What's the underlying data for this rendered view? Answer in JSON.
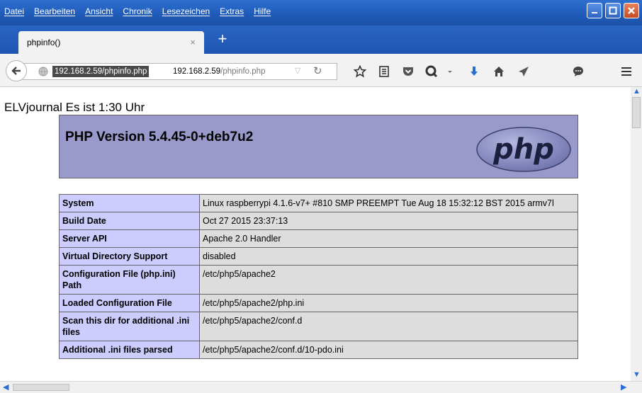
{
  "menubar": {
    "items": [
      "Datei",
      "Bearbeiten",
      "Ansicht",
      "Chronik",
      "Lesezeichen",
      "Extras",
      "Hilfe"
    ]
  },
  "tab": {
    "title": "phpinfo()",
    "close": "×",
    "new_tab": "+"
  },
  "navbar": {
    "url_selected": "192.168.2.59/phpinfo.php",
    "url_host": "192.168.2.59",
    "url_path": "/phpinfo.php"
  },
  "page": {
    "heading": "ELVjournal Es ist 1:30 Uhr",
    "php_version": "PHP Version 5.4.45-0+deb7u2",
    "logo_text": "php",
    "rows": [
      {
        "key": "System",
        "value": "Linux raspberrypi 4.1.6-v7+ #810 SMP PREEMPT Tue Aug 18 15:32:12 BST 2015 armv7l"
      },
      {
        "key": "Build Date",
        "value": "Oct 27 2015 23:37:13"
      },
      {
        "key": "Server API",
        "value": "Apache 2.0 Handler"
      },
      {
        "key": "Virtual Directory Support",
        "value": "disabled"
      },
      {
        "key": "Configuration File (php.ini) Path",
        "value": "/etc/php5/apache2"
      },
      {
        "key": "Loaded Configuration File",
        "value": "/etc/php5/apache2/php.ini"
      },
      {
        "key": "Scan this dir for additional .ini files",
        "value": "/etc/php5/apache2/conf.d"
      },
      {
        "key": "Additional .ini files parsed",
        "value": "/etc/php5/apache2/conf.d/10-pdo.ini"
      }
    ]
  },
  "colors": {
    "titlebar": "#1f5ab8",
    "php_header": "#9999cc",
    "key_cell": "#ccccff",
    "value_cell": "#dddddd"
  },
  "icons": [
    "back-icon",
    "globe-icon",
    "dropdown-icon",
    "reload-icon",
    "bookmark-star-icon",
    "reading-list-icon",
    "pocket-icon",
    "search-q-icon",
    "download-icon",
    "home-icon",
    "send-icon",
    "chat-icon",
    "hamburger-menu-icon"
  ]
}
